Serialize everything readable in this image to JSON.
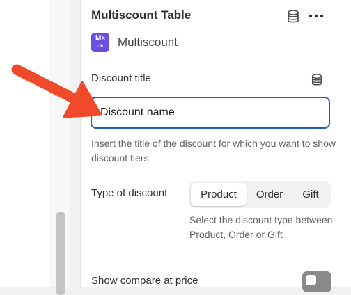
{
  "panel": {
    "title": "Multiscount Table",
    "app": {
      "badge_text": "Ms",
      "badge_sub": "c⊕",
      "name": "Multiscount",
      "badge_color": "#6c4fe0"
    }
  },
  "discount_title": {
    "label": "Discount title",
    "value": "Discount name",
    "help": "Insert the title of the discount for which you want to show discount tiers"
  },
  "discount_type": {
    "label": "Type of discount",
    "options": [
      "Product",
      "Order",
      "Gift"
    ],
    "selected": "Product",
    "help": "Select the discount type between Product, Order or Gift"
  },
  "compare_price": {
    "label": "Show compare at price",
    "enabled": false
  },
  "icons": {
    "header_dynamic_source": "database-icon",
    "header_more": "more-horizontal-icon",
    "field_dynamic_source": "database-icon"
  },
  "colors": {
    "accent_focus": "#1f5fb0",
    "annotation_arrow": "#f04a2a"
  }
}
